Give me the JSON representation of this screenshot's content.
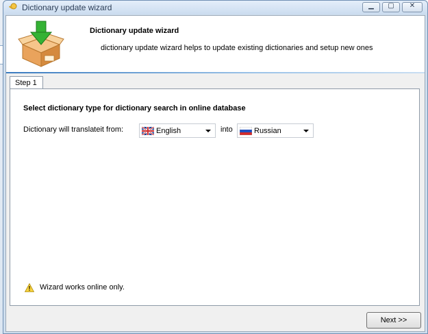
{
  "window": {
    "title": "Dictionary update wizard",
    "icon": "key-icon",
    "controls": [
      "minimize-icon",
      "maximize-icon",
      "close-icon"
    ]
  },
  "header": {
    "title": "Dictionary update wizard",
    "description": "dictionary update wizard helps to update existing dictionaries and setup new ones",
    "icon": "box-download-icon"
  },
  "tabs": [
    {
      "label": "Step 1",
      "active": true
    }
  ],
  "step1": {
    "section_title": "Select dictionary type for dictionary search in online database",
    "from_label": "Dictionary will translateit from:",
    "from_value": "English",
    "from_flag": "uk-flag-icon",
    "into_label": "into",
    "to_value": "Russian",
    "to_flag": "russia-flag-icon",
    "warning": "Wizard works online only."
  },
  "buttons": {
    "next": "Next >>"
  },
  "colors": {
    "accent": "#3a7bbf",
    "warning": "#f2c200",
    "download_arrow": "#2ea02e"
  }
}
